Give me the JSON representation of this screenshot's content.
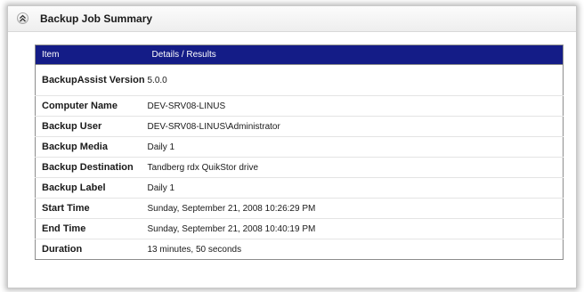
{
  "panel": {
    "title": "Backup Job Summary",
    "collapse_icon": "double-chevron-up-icon"
  },
  "table": {
    "headers": {
      "item": "Item",
      "details": "Details / Results"
    },
    "rows": [
      {
        "item": "BackupAssist Version",
        "value": "5.0.0"
      },
      {
        "item": "Computer Name",
        "value": "DEV-SRV08-LINUS"
      },
      {
        "item": "Backup User",
        "value": "DEV-SRV08-LINUS\\Administrator"
      },
      {
        "item": "Backup Media",
        "value": "Daily 1"
      },
      {
        "item": "Backup Destination",
        "value": "Tandberg rdx QuikStor drive"
      },
      {
        "item": "Backup Label",
        "value": "Daily 1"
      },
      {
        "item": "Start Time",
        "value": "Sunday, September 21, 2008 10:26:29 PM"
      },
      {
        "item": "End Time",
        "value": "Sunday, September 21, 2008 10:40:19 PM"
      },
      {
        "item": "Duration",
        "value": "13 minutes, 50 seconds"
      }
    ]
  },
  "colors": {
    "header_bg": "#141c87",
    "header_text": "#ffffff"
  }
}
